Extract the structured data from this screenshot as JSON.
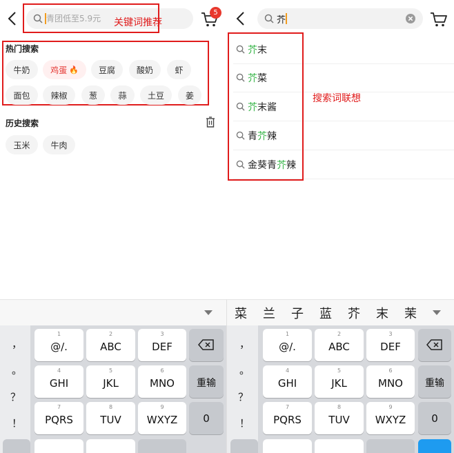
{
  "left": {
    "search_placeholder": "青团低至5.9元",
    "cart_badge": "5",
    "annotation_label": "关键词推荐",
    "hot_section_title": "热门搜索",
    "hot_row1": [
      "牛奶",
      "鸡蛋",
      "豆腐",
      "酸奶",
      "虾"
    ],
    "hot_row2": [
      "面包",
      "辣椒",
      "葱",
      "蒜",
      "土豆",
      "姜"
    ],
    "history_title": "历史搜索",
    "history_items": [
      "玉米",
      "牛肉"
    ]
  },
  "right": {
    "search_value": "芥",
    "annotation_label": "搜索词联想",
    "suggestions": [
      {
        "hl": "芥",
        "rest": "末",
        "pre": ""
      },
      {
        "hl": "芥",
        "rest": "菜",
        "pre": ""
      },
      {
        "hl": "芥",
        "rest": "末酱",
        "pre": ""
      },
      {
        "hl": "芥",
        "rest": "辣",
        "pre": "青"
      },
      {
        "hl": "芥",
        "rest": "辣",
        "pre": "金葵青"
      }
    ],
    "candidates": [
      "菜",
      "兰",
      "子",
      "蓝",
      "芥",
      "末",
      "茉"
    ]
  },
  "keyboard": {
    "symbols": [
      "，",
      "。",
      "？",
      "！"
    ],
    "row1": [
      {
        "num": "1",
        "lbl": "@/."
      },
      {
        "num": "2",
        "lbl": "ABC"
      },
      {
        "num": "3",
        "lbl": "DEF"
      }
    ],
    "row2": [
      {
        "num": "4",
        "lbl": "GHI"
      },
      {
        "num": "5",
        "lbl": "JKL"
      },
      {
        "num": "6",
        "lbl": "MNO"
      }
    ],
    "row3": [
      {
        "num": "7",
        "lbl": "PQRS"
      },
      {
        "num": "8",
        "lbl": "TUV"
      },
      {
        "num": "9",
        "lbl": "WXYZ"
      }
    ],
    "reenter": "重输",
    "zero": "0"
  },
  "colors": {
    "accent": "#39b54a",
    "annotation": "#e01b1b",
    "badge": "#e8382d"
  }
}
